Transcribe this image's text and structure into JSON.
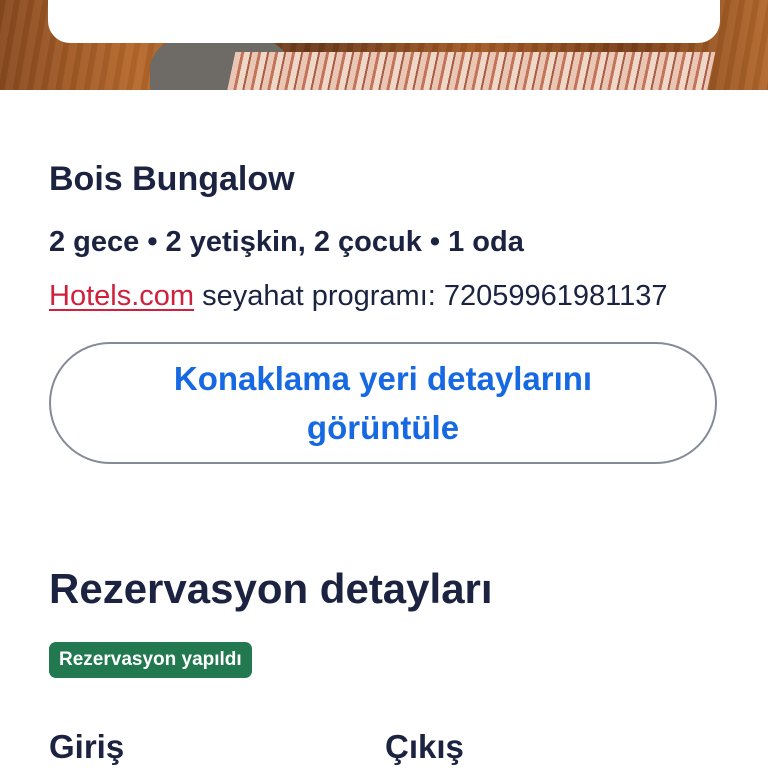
{
  "property": {
    "name": "Bois Bungalow",
    "stay_summary": "2 gece • 2 yetişkin, 2 çocuk • 1 oda",
    "itinerary_brand": "Hotels.com",
    "itinerary_text": " seyahat programı: 72059961981137"
  },
  "actions": {
    "view_property_details_label": "Konaklama yeri detaylarını görüntüle"
  },
  "reservation": {
    "section_title": "Rezervasyon detayları",
    "status_badge": "Rezervasyon yapıldı",
    "checkin_label": "Giriş",
    "checkout_label": "Çıkış"
  },
  "colors": {
    "text_primary": "#1b2340",
    "link_blue": "#1668e3",
    "brand_red": "#d0203c",
    "badge_green": "#227950",
    "button_border": "#858a99"
  }
}
